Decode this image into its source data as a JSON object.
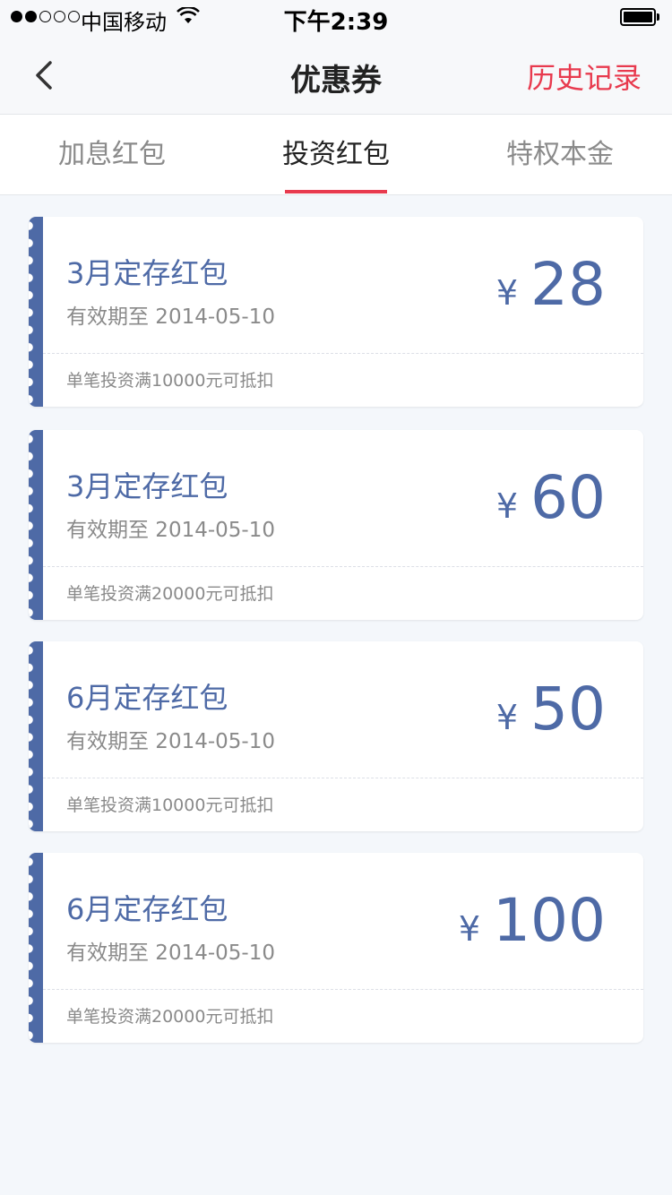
{
  "status_bar": {
    "carrier": "中国移动",
    "time": "下午2:39"
  },
  "nav": {
    "title": "优惠券",
    "history_label": "历史记录"
  },
  "tabs": [
    {
      "label": "加息红包",
      "active": false
    },
    {
      "label": "投资红包",
      "active": true
    },
    {
      "label": "特权本金",
      "active": false
    }
  ],
  "coupons": [
    {
      "name": "3月定存红包",
      "validity": "有效期至 2014-05-10",
      "currency": "¥",
      "amount": "28",
      "condition": "单笔投资满10000元可抵扣"
    },
    {
      "name": "3月定存红包",
      "validity": "有效期至 2014-05-10",
      "currency": "¥",
      "amount": "60",
      "condition": "单笔投资满20000元可抵扣"
    },
    {
      "name": "6月定存红包",
      "validity": "有效期至 2014-05-10",
      "currency": "¥",
      "amount": "50",
      "condition": "单笔投资满10000元可抵扣"
    },
    {
      "name": "6月定存红包",
      "validity": "有效期至 2014-05-10",
      "currency": "¥",
      "amount": "100",
      "condition": "单笔投资满20000元可抵扣"
    }
  ],
  "colors": {
    "accent": "#e83a4e",
    "coupon_blue": "#4e6aa6",
    "background": "#f4f7fb"
  },
  "icons": {
    "back": "chevron-left-icon",
    "wifi": "wifi-icon",
    "battery": "battery-icon"
  }
}
